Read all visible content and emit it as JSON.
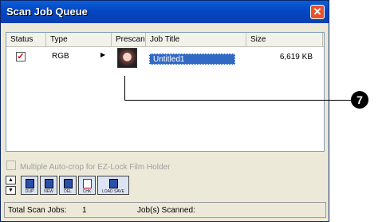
{
  "window": {
    "title": "Scan Job Queue",
    "close_symbol": "✕"
  },
  "list": {
    "headers": [
      "Status",
      "Type",
      "Prescan",
      "Job Title",
      "Size"
    ],
    "rows": [
      {
        "status_checked": "✓",
        "type": "RGB",
        "expand_symbol": "▶",
        "job_title": "Untitled1",
        "size": "6,619 KB"
      }
    ]
  },
  "option": {
    "label": "Multiple Auto-crop for EZ-Lock Film Holder"
  },
  "toolbar": {
    "buttons": [
      {
        "label": "DUP",
        "icon": "duplicate-icon"
      },
      {
        "label": "NEW",
        "icon": "new-icon"
      },
      {
        "label": "DEL",
        "icon": "delete-icon"
      },
      {
        "label": "CHK",
        "icon": "check-icon"
      },
      {
        "label": "LOAD SAVE",
        "icon": "load-save-icon"
      }
    ],
    "move_up_symbol": "▲",
    "move_down_symbol": "▼"
  },
  "status": {
    "total_label": "Total Scan Jobs:",
    "total_value": "1",
    "scanned_label": "Job(s) Scanned:"
  },
  "callout": {
    "number": "7"
  }
}
